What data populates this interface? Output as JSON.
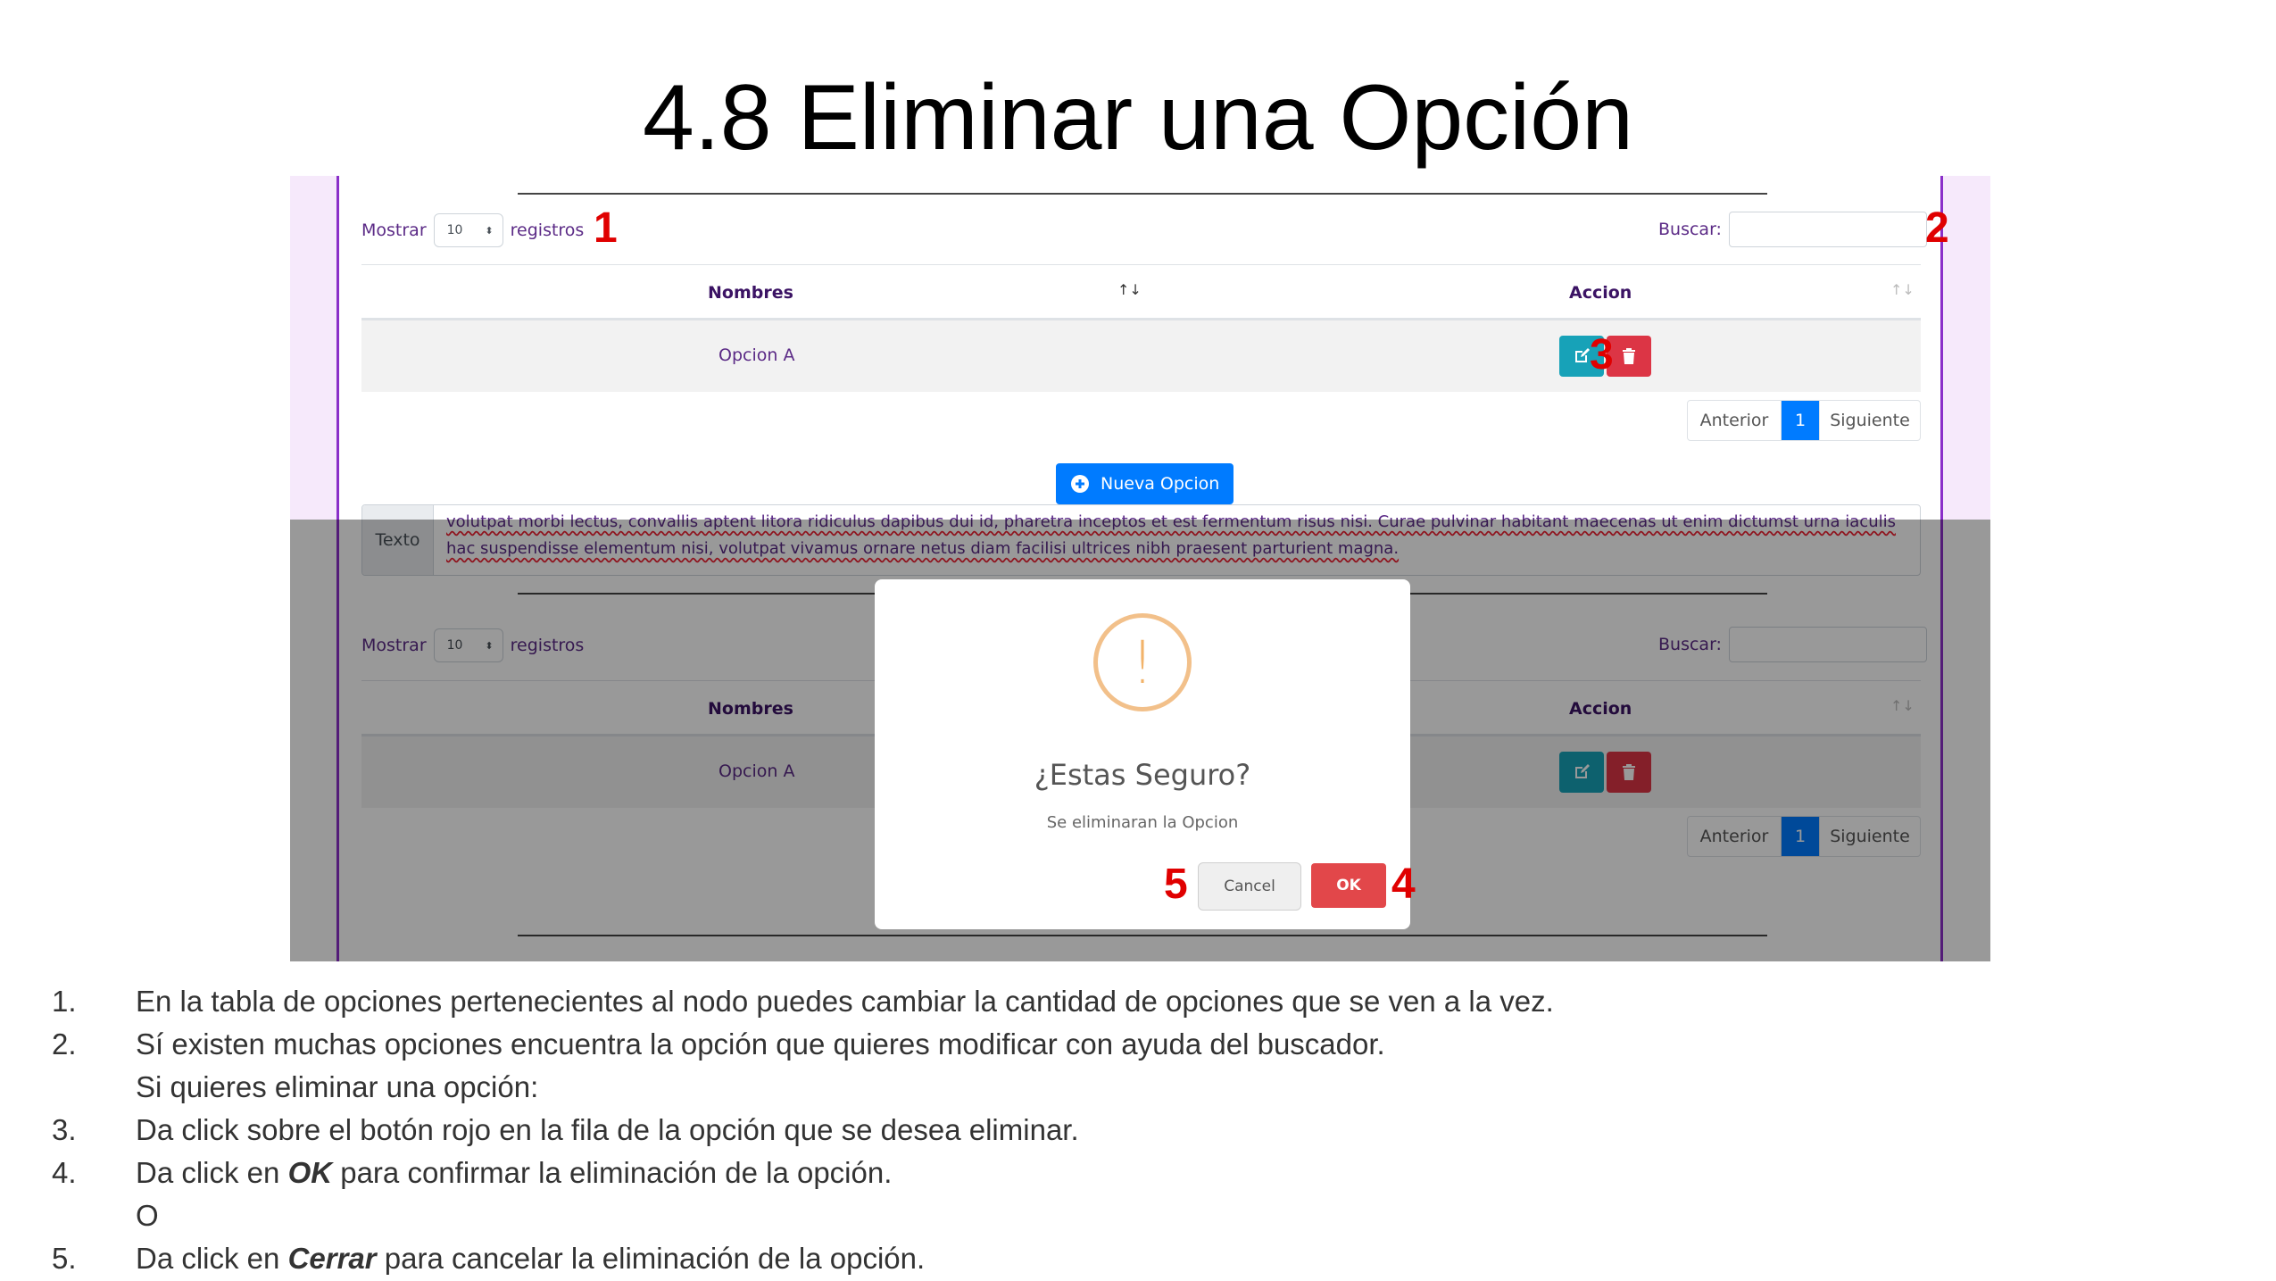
{
  "slide": {
    "title": "4.8 Eliminar una Opción"
  },
  "table_top": {
    "show_label": "Mostrar",
    "show_value": "10",
    "records_label": "registros",
    "search_label": "Buscar:",
    "col_names": "Nombres",
    "col_action": "Accion",
    "sort_icon_names": "↑↓",
    "sort_icon_action": "↑↓",
    "row_name": "Opcion A",
    "prev_label": "Anterior",
    "page": "1",
    "next_label": "Siguiente",
    "new_button": "Nueva Opcion"
  },
  "table_bottom": {
    "texto_label": "Texto",
    "texto_content": "volutpat morbi lectus, convallis aptent litora ridiculus dapibus dui id, pharetra inceptos et est fermentum risus nisi. Curae pulvinar habitant maecenas ut enim dictumst urna iaculis hac suspendisse elementum nisi, volutpat vivamus ornare netus diam facilisi ultrices nibh praesent parturient magna.",
    "show_label": "Mostrar",
    "show_value": "10",
    "records_label": "registros",
    "search_label": "Buscar:",
    "col_names": "Nombres",
    "col_action": "Accion",
    "sort_icon_action": "↑↓",
    "row_name": "Opcion A",
    "prev_label": "Anterior",
    "page": "1",
    "next_label": "Siguiente"
  },
  "modal": {
    "icon": "!",
    "title": "¿Estas Seguro?",
    "text": "Se eliminaran la Opcion",
    "cancel_label": "Cancel",
    "ok_label": "OK"
  },
  "markers": {
    "m1": "1",
    "m2": "2",
    "m3": "3",
    "m4": "4",
    "m5": "5"
  },
  "steps": [
    {
      "num": "1.",
      "text": "En la tabla de opciones pertenecientes al nodo puedes cambiar la cantidad de opciones que se ven a la vez."
    },
    {
      "num": "2.",
      "text": "Sí existen muchas opciones encuentra la opción que quieres modificar con ayuda del buscador."
    },
    {
      "num": "",
      "text": "Si quieres eliminar una opción:"
    },
    {
      "num": "3.",
      "text": "Da click sobre el botón rojo en la fila de la opción que se desea eliminar."
    },
    {
      "num": "4.",
      "pre": "Da click en ",
      "em": "OK",
      "post": " para confirmar la eliminación de la opción."
    },
    {
      "num": "",
      "text": "O"
    },
    {
      "num": "5.",
      "pre": "Da click en ",
      "em": "Cerrar",
      "post": " para cancelar la eliminación de la opción."
    }
  ]
}
